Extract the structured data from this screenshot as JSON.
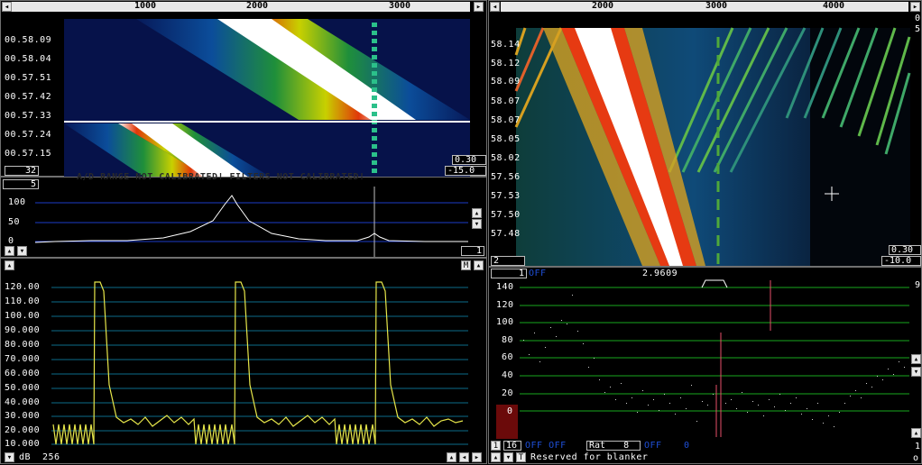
{
  "left_waterfall": {
    "freq_ticks": [
      "1000",
      "2000",
      "3000"
    ],
    "time_labels": [
      "00.58.09",
      "00.58.04",
      "00.57.51",
      "00.57.42",
      "00.57.33",
      "00.57.24",
      "00.57.15"
    ],
    "gain_box": "0.30",
    "level_box": "-15.0",
    "avg_box": "32"
  },
  "left_spectrum": {
    "header_box": "5",
    "ticks": [
      "100",
      "50",
      "0"
    ],
    "overlay_text": "A/D RANGE NOT CALIBRATED!    FILTERS NOT CALIBRATED!",
    "right_box": "1"
  },
  "left_timeplot": {
    "y_labels": [
      "120.00",
      "110.00",
      "100.00",
      "90.000",
      "80.000",
      "70.000",
      "60.000",
      "50.000",
      "40.000",
      "30.000",
      "20.000",
      "10.000"
    ],
    "m_label": "M",
    "bottom_unit": "dB",
    "bottom_value": "256"
  },
  "right_waterfall": {
    "freq_ticks": [
      "2000",
      "3000",
      "4000"
    ],
    "time_labels": [
      "58.14",
      "58.12",
      "58.09",
      "58.07",
      "58.07",
      "58.05",
      "58.02",
      "57.56",
      "57.53",
      "57.50",
      "57.48"
    ],
    "right_digits": [
      "0",
      "5"
    ],
    "gain_box": "0.30",
    "level_box": "-10.0",
    "left_box": "2"
  },
  "right_plot": {
    "header_value": "1",
    "off_label": "OFF",
    "freq_readout": "2.9609",
    "y_labels": [
      "140",
      "120",
      "100",
      "80",
      "60",
      "40",
      "20",
      "0"
    ],
    "right_top_digit": "9",
    "right_bottom_digit": "1",
    "bottom_box": "16",
    "toggles": "OFF OFF",
    "rat_label": "Rat",
    "rat_value": "8",
    "off2_label": "OFF",
    "off2_value": "0",
    "status": "Reserved for blanker",
    "corner_letter": "o",
    "t_letter": "T"
  }
}
